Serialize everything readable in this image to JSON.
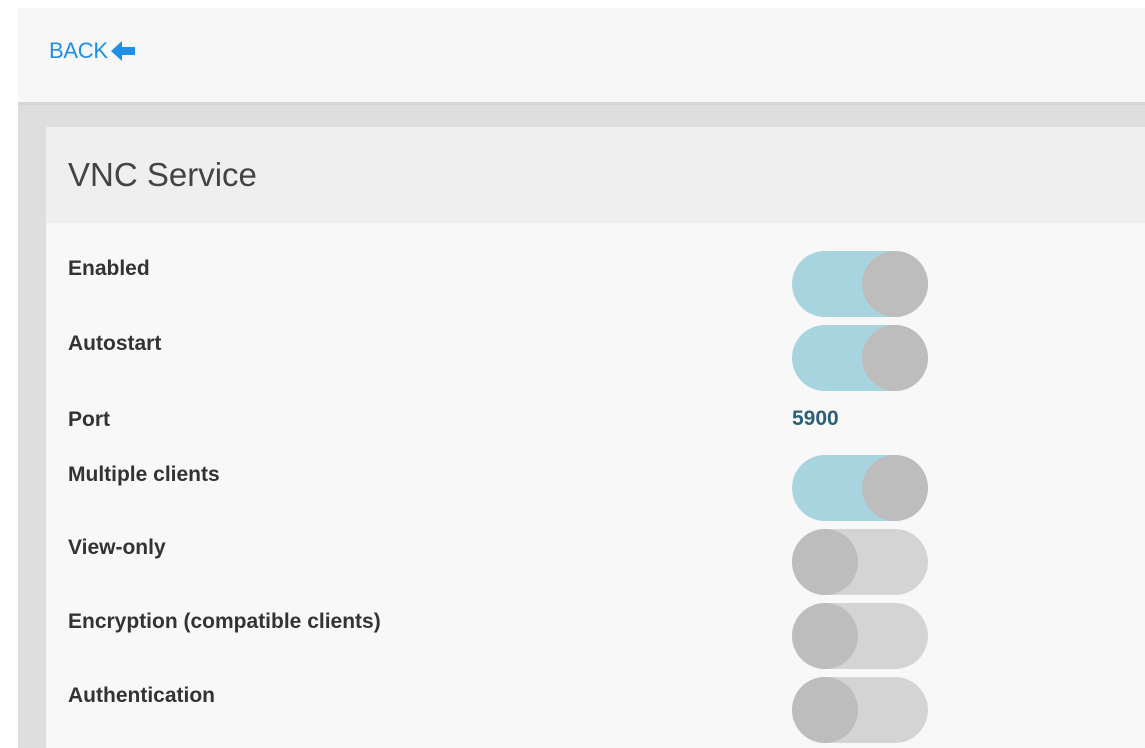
{
  "nav": {
    "back_label": "BACK",
    "back_icon": "arrow-left-icon"
  },
  "section": {
    "title": "VNC Service"
  },
  "settings": {
    "enabled": {
      "label": "Enabled",
      "state": "on"
    },
    "autostart": {
      "label": "Autostart",
      "state": "on"
    },
    "port": {
      "label": "Port",
      "value": "5900"
    },
    "multiple_clients": {
      "label": "Multiple clients",
      "state": "on"
    },
    "view_only": {
      "label": "View-only",
      "state": "off"
    },
    "encryption": {
      "label": "Encryption (compatible clients)",
      "state": "off"
    },
    "authentication": {
      "label": "Authentication",
      "state": "off"
    }
  },
  "colors": {
    "link": "#1f8fe6",
    "toggle_on_track": "#a8d4e0",
    "toggle_off_track": "#d4d4d4",
    "toggle_knob": "#bdbdbd",
    "port_value": "#2d5f7a"
  }
}
